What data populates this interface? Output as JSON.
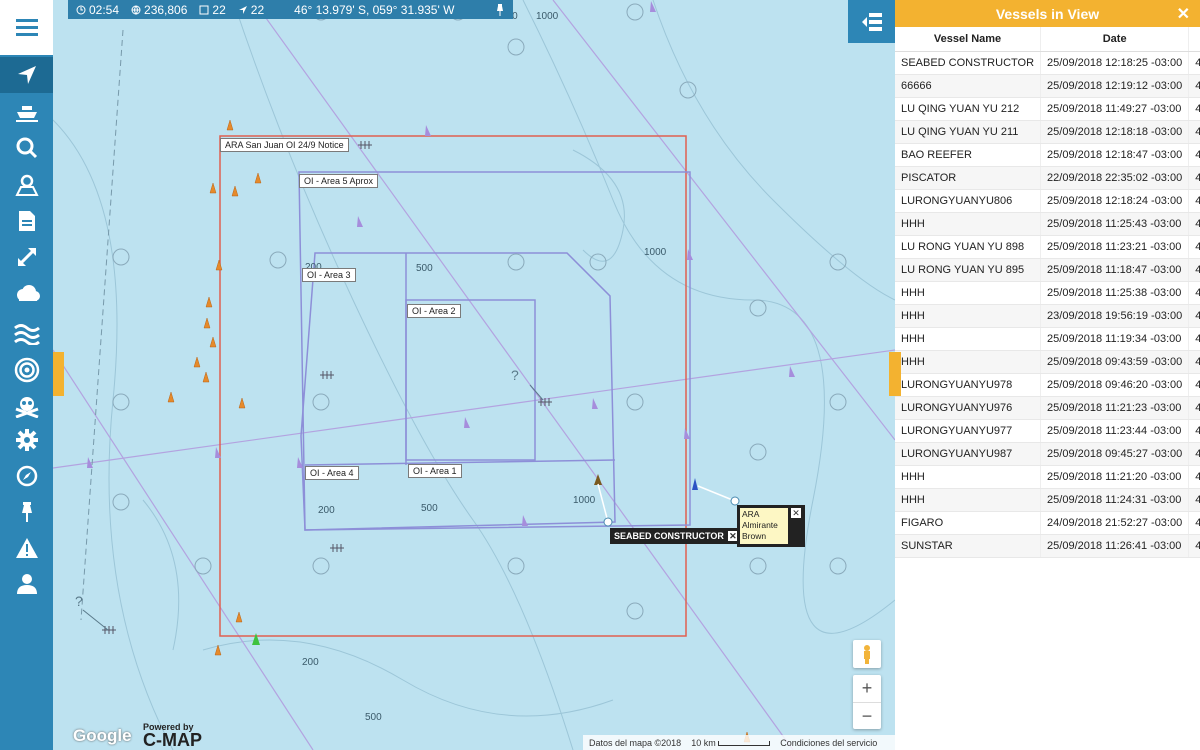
{
  "status": {
    "time": "02:54",
    "users": "236,806",
    "messages": "22",
    "vessels": "22",
    "coordinates": "46° 13.979' S, 059° 31.935' W"
  },
  "areas": {
    "notice": "ARA San Juan OI 24/9 Notice",
    "area5": "OI - Area 5 Aprox",
    "area3": "OI - Area 3",
    "area2": "OI - Area 2",
    "area4": "OI - Area 4",
    "area1": "OI - Area 1"
  },
  "depths": [
    "500",
    "1000",
    "500",
    "1000",
    "1000",
    "500",
    "200",
    "200",
    "500",
    "200",
    "500"
  ],
  "vessel_popups": {
    "seabed": "SEABED CONSTRUCTOR",
    "ara_line1": "ARA",
    "ara_line2": "Almirante",
    "ara_line3": "Brown"
  },
  "map_footer": {
    "google": "Google",
    "cmap_powered": "Powered by",
    "cmap": "C-MAP",
    "data": "Datos del mapa ©2018",
    "scale": "10 km",
    "terms": "Condiciones del servicio"
  },
  "zoom": {
    "plus": "+",
    "minus": "−"
  },
  "panel": {
    "title": "Vessels in View",
    "close": "✕",
    "columns": [
      "Vessel Name",
      "Date",
      "L"
    ],
    "rows": [
      {
        "name": "SEABED CONSTRUCTOR",
        "date": "25/09/2018 12:18:25 -03:00",
        "lat": "46°"
      },
      {
        "name": "66666",
        "date": "25/09/2018 12:19:12 -03:00",
        "lat": "46°"
      },
      {
        "name": "LU QING YUAN YU 212",
        "date": "25/09/2018 11:49:27 -03:00",
        "lat": "46°"
      },
      {
        "name": "LU QING YUAN YU 211",
        "date": "25/09/2018 12:18:18 -03:00",
        "lat": "46°"
      },
      {
        "name": "BAO REEFER",
        "date": "25/09/2018 12:18:47 -03:00",
        "lat": "46°"
      },
      {
        "name": "PISCATOR",
        "date": "22/09/2018 22:35:02 -03:00",
        "lat": "46°"
      },
      {
        "name": "LURONGYUANYU806",
        "date": "25/09/2018 12:18:24 -03:00",
        "lat": "46°"
      },
      {
        "name": "HHH",
        "date": "25/09/2018 11:25:43 -03:00",
        "lat": "45°"
      },
      {
        "name": "LU RONG YUAN YU 898",
        "date": "25/09/2018 11:23:21 -03:00",
        "lat": "45°"
      },
      {
        "name": "LU RONG YUAN YU 895",
        "date": "25/09/2018 11:18:47 -03:00",
        "lat": "45°"
      },
      {
        "name": "HHH",
        "date": "25/09/2018 11:25:38 -03:00",
        "lat": "45°"
      },
      {
        "name": "HHH",
        "date": "23/09/2018 19:56:19 -03:00",
        "lat": "45°"
      },
      {
        "name": "HHH",
        "date": "25/09/2018 11:19:34 -03:00",
        "lat": "45°"
      },
      {
        "name": "HHH",
        "date": "25/09/2018 09:43:59 -03:00",
        "lat": "46°"
      },
      {
        "name": "LURONGYUANYU978",
        "date": "25/09/2018 09:46:20 -03:00",
        "lat": "45°"
      },
      {
        "name": "LURONGYUANYU976",
        "date": "25/09/2018 11:21:23 -03:00",
        "lat": "45°"
      },
      {
        "name": "LURONGYUANYU977",
        "date": "25/09/2018 11:23:44 -03:00",
        "lat": "45°"
      },
      {
        "name": "LURONGYUANYU987",
        "date": "25/09/2018 09:45:27 -03:00",
        "lat": "45°"
      },
      {
        "name": "HHH",
        "date": "25/09/2018 11:21:20 -03:00",
        "lat": "45°"
      },
      {
        "name": "HHH",
        "date": "25/09/2018 11:24:31 -03:00",
        "lat": "45°"
      },
      {
        "name": "FIGARO",
        "date": "24/09/2018 21:52:27 -03:00",
        "lat": "46°"
      },
      {
        "name": "SUNSTAR",
        "date": "25/09/2018 11:26:41 -03:00",
        "lat": "46°"
      }
    ]
  }
}
